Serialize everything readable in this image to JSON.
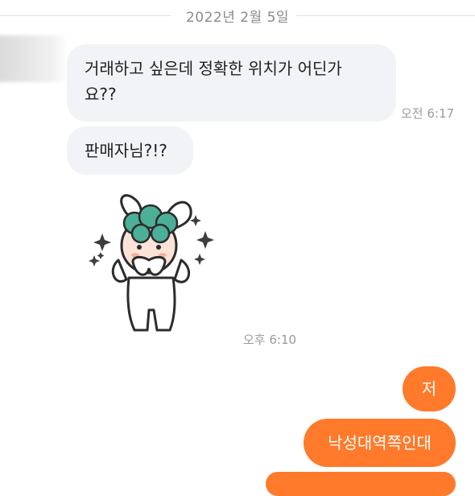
{
  "date_separator": "2022년 2월 5일",
  "messages_incoming": [
    {
      "text": "거래하고 싶은데 정확한 위치가 어딘가\n요??"
    },
    {
      "text": "판매자님?!?"
    }
  ],
  "timestamps": {
    "first_group": "오전 6:17",
    "sticker": "오후 6:10"
  },
  "sticker": {
    "icon": "bunny-sticker-icon",
    "description_icon": "surprised-bunny-with-sparkles"
  },
  "messages_outgoing": [
    {
      "text": "저"
    },
    {
      "text": "낙성대역쪽인대"
    }
  ],
  "colors": {
    "incoming_bubble": "#f2f3f6",
    "outgoing_bubble": "#ff7a2a",
    "timestamp": "#9a9a9a"
  }
}
